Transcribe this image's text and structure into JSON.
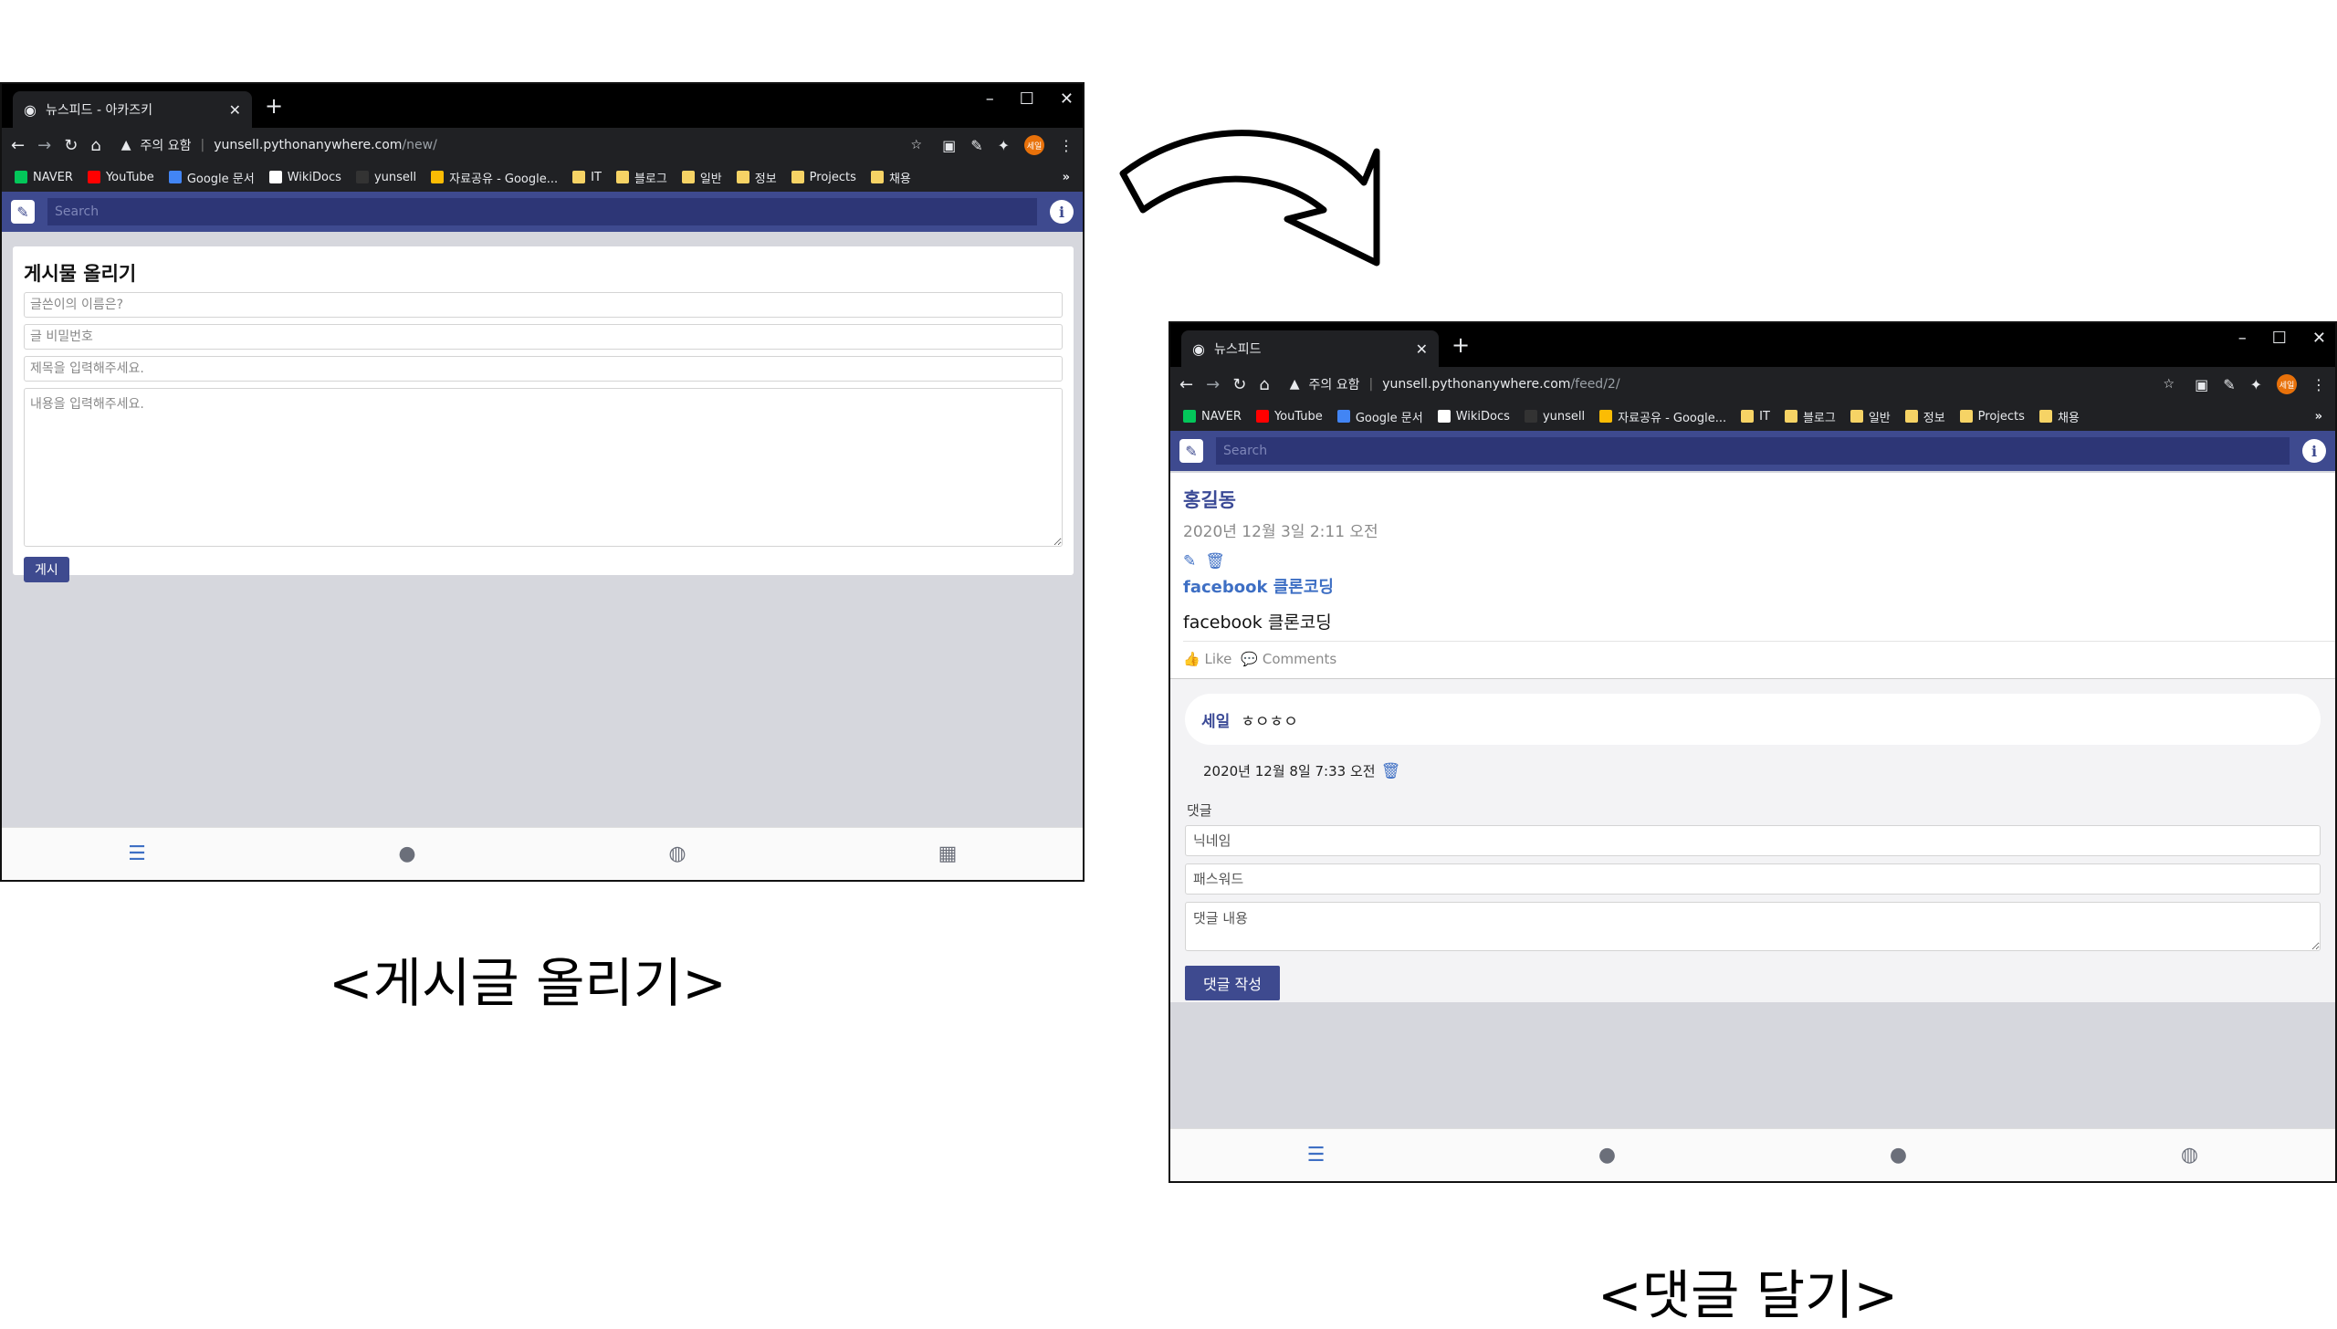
{
  "captions": {
    "left": "<게시글 올리기>",
    "right": "<댓글 달기>"
  },
  "browser_common": {
    "security_warning": "주의 요함",
    "bookmarks": [
      {
        "label": "NAVER",
        "color": "#03c75a"
      },
      {
        "label": "YouTube",
        "color": "#ff0000"
      },
      {
        "label": "Google 문서",
        "color": "#4285f4"
      },
      {
        "label": "WikiDocs",
        "color": "#ffffff"
      },
      {
        "label": "yunsell",
        "color": "#202124"
      },
      {
        "label": "자료공유 - Google...",
        "color": "#fbbc04"
      },
      {
        "label": "IT",
        "color": "#f6d365"
      },
      {
        "label": "블로그",
        "color": "#f6d365"
      },
      {
        "label": "일반",
        "color": "#f6d365"
      },
      {
        "label": "정보",
        "color": "#f6d365"
      },
      {
        "label": "Projects",
        "color": "#f6d365"
      },
      {
        "label": "채용",
        "color": "#f6d365"
      }
    ],
    "more_bookmarks": "»",
    "profile_badge": "세일",
    "search_placeholder": "Search"
  },
  "left_window": {
    "tab_title": "뉴스피드 - 아카즈키",
    "url_host": "yunsell.pythonanywhere.com",
    "url_path": "/new/",
    "form": {
      "heading": "게시물 올리기",
      "author_placeholder": "글쓴이의 이름은?",
      "password_placeholder": "글 비밀번호",
      "title_placeholder": "제목을 입력해주세요.",
      "content_placeholder": "내용을 입력해주세요.",
      "submit_label": "게시"
    }
  },
  "right_window": {
    "tab_title": "뉴스피드",
    "url_host": "yunsell.pythonanywhere.com",
    "url_path": "/feed/2/",
    "post": {
      "author": "홍길동",
      "date": "2020년 12월 3일 2:11 오전",
      "title": "facebook 클론코딩",
      "body": "facebook 클론코딩",
      "like_label": "Like",
      "comments_label": "Comments"
    },
    "comment": {
      "name": "세일",
      "text": "ㅎㅇㅎㅇ",
      "date": "2020년 12월 8일 7:33 오전"
    },
    "comment_form": {
      "label": "댓글",
      "nickname_placeholder": "닉네임",
      "password_placeholder": "패스워드",
      "content_placeholder": "댓글 내용",
      "submit_label": "댓글 작성"
    }
  },
  "colors": {
    "brand": "#3e4a8f",
    "link": "#3e6fc4",
    "chrome_dark": "#202124"
  }
}
